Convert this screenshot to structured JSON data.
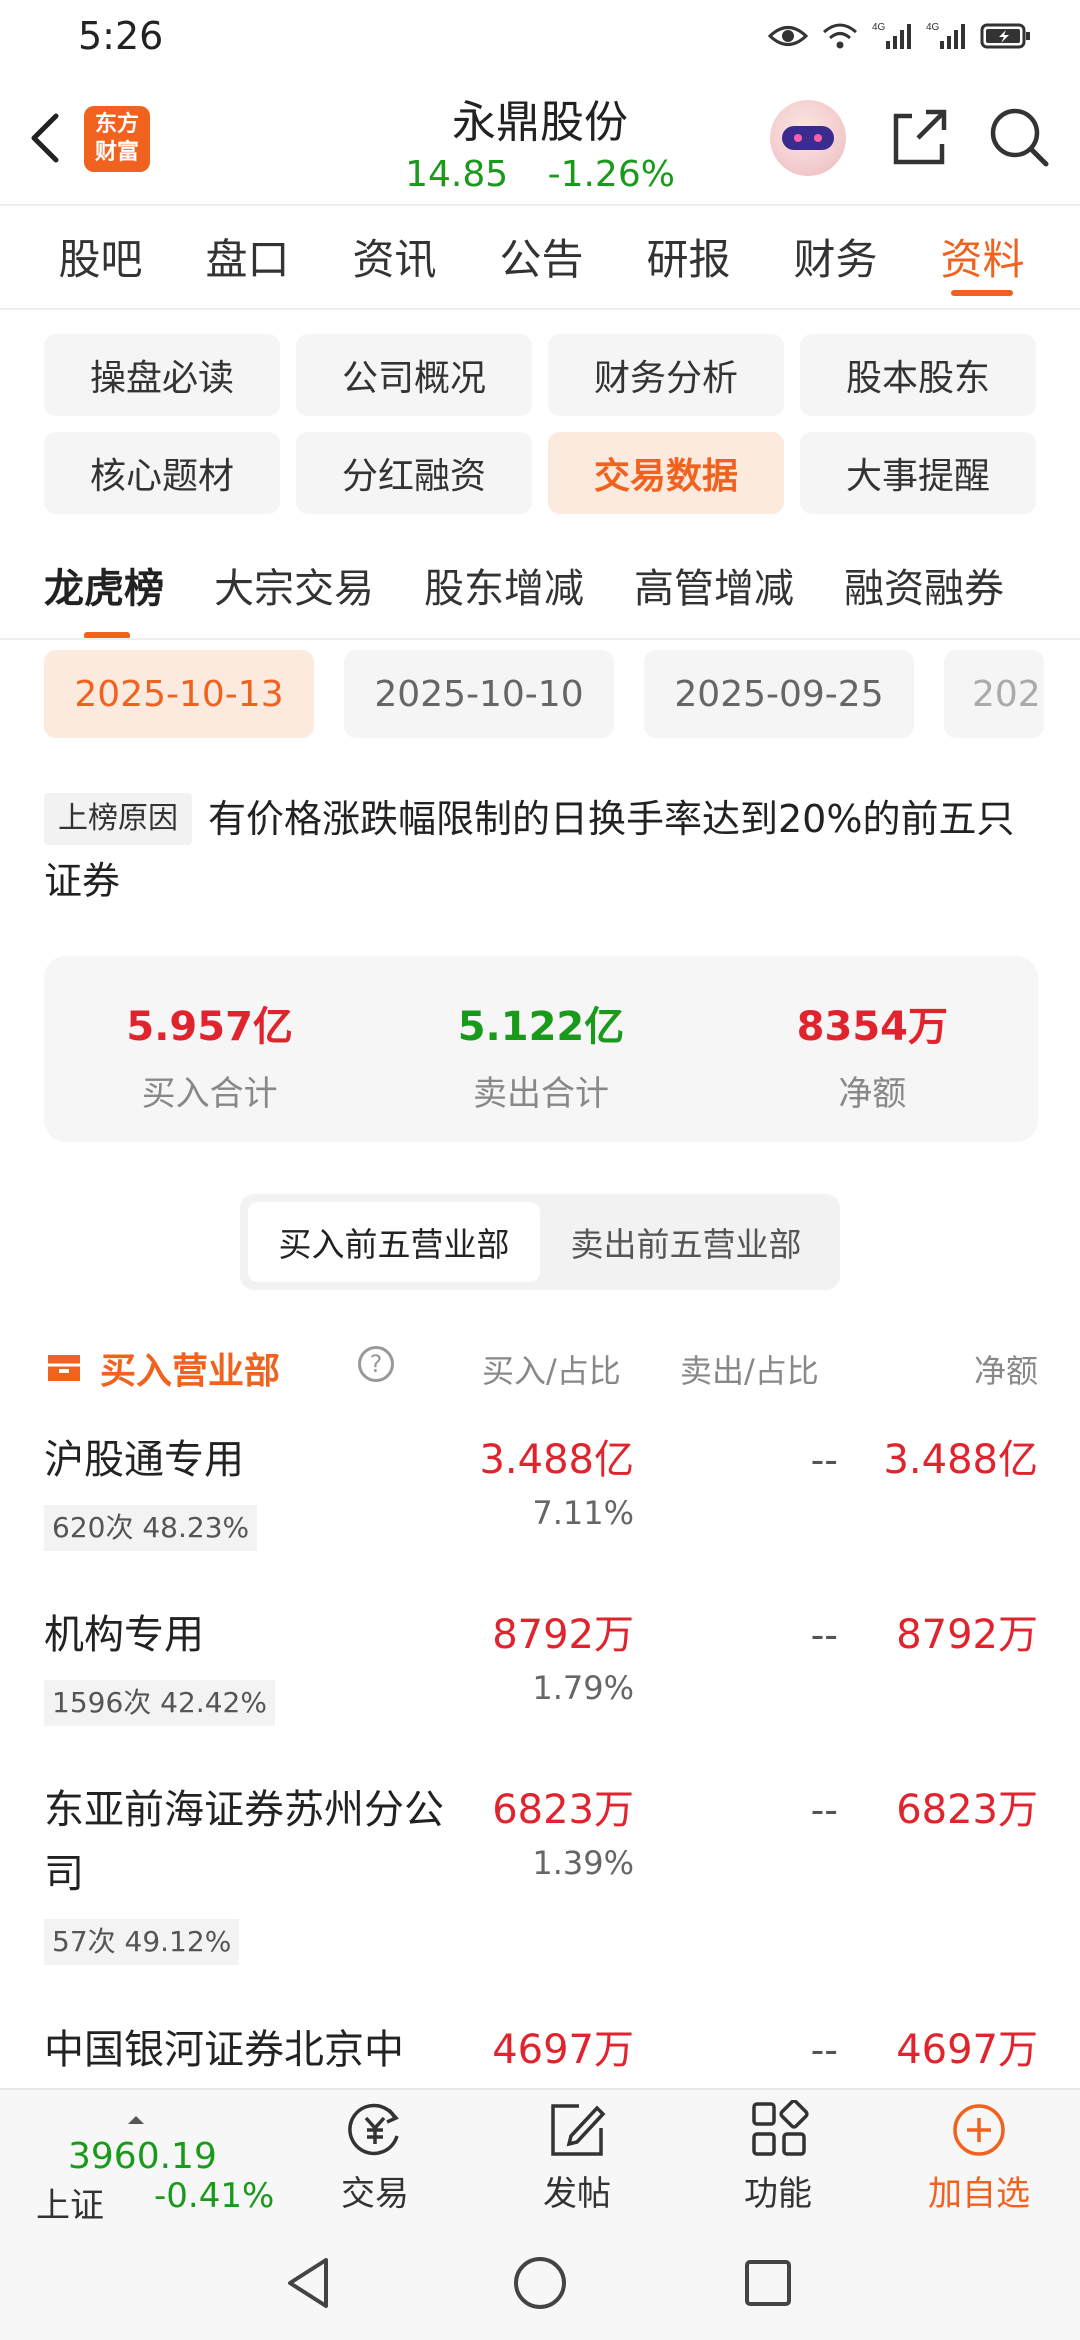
{
  "status_bar": {
    "time": "5:26",
    "net1": "4G",
    "net2": "4G"
  },
  "header": {
    "logo_line1": "东方",
    "logo_line2": "财富",
    "stock_name": "永鼎股份",
    "price": "14.85",
    "change_pct": "-1.26%"
  },
  "main_tabs": [
    {
      "label": "股吧"
    },
    {
      "label": "盘口"
    },
    {
      "label": "资讯"
    },
    {
      "label": "公告"
    },
    {
      "label": "研报"
    },
    {
      "label": "财务"
    },
    {
      "label": "资料",
      "active": true
    }
  ],
  "categories": [
    {
      "label": "操盘必读"
    },
    {
      "label": "公司概况"
    },
    {
      "label": "财务分析"
    },
    {
      "label": "股本股东"
    },
    {
      "label": "核心题材"
    },
    {
      "label": "分红融资"
    },
    {
      "label": "交易数据",
      "active": true
    },
    {
      "label": "大事提醒"
    }
  ],
  "sub_tabs": [
    {
      "label": "龙虎榜",
      "active": true
    },
    {
      "label": "大宗交易"
    },
    {
      "label": "股东增减"
    },
    {
      "label": "高管增减"
    },
    {
      "label": "融资融券"
    }
  ],
  "dates": [
    {
      "label": "2025-10-13",
      "active": true
    },
    {
      "label": "2025-10-10"
    },
    {
      "label": "2025-09-25"
    },
    {
      "label": "202"
    }
  ],
  "reason": {
    "tag": "上榜原因",
    "text": "有价格涨跌幅限制的日换手率达到20%的前五只证券"
  },
  "summary": {
    "buy_total": "5.957亿",
    "buy_label": "买入合计",
    "sell_total": "5.122亿",
    "sell_label": "卖出合计",
    "net": "8354万",
    "net_label": "净额"
  },
  "segment": {
    "buy_top": "买入前五营业部",
    "sell_top": "卖出前五营业部"
  },
  "table": {
    "title": "买入营业部",
    "help": "?",
    "col_buy": "买入/占比",
    "col_sell": "卖出/占比",
    "col_net": "净额",
    "rows": [
      {
        "name": "沪股通专用",
        "stats": "620次 48.23%",
        "buy": "3.488亿",
        "buy_pct": "7.11%",
        "sell": "--",
        "net": "3.488亿"
      },
      {
        "name": "机构专用",
        "stats": "1596次 42.42%",
        "buy": "8792万",
        "buy_pct": "1.79%",
        "sell": "--",
        "net": "8792万"
      },
      {
        "name": "东亚前海证券苏州分公司",
        "stats": "57次 49.12%",
        "buy": "6823万",
        "buy_pct": "1.39%",
        "sell": "--",
        "net": "6823万"
      },
      {
        "name": "中国银河证券北京中",
        "buy": "4697万",
        "sell": "--",
        "net": "4697万"
      }
    ]
  },
  "bottom_nav": {
    "index_value": "3960.19",
    "index_name": "上证",
    "index_change": "-0.41%",
    "trade": "交易",
    "post": "发帖",
    "functions": "功能",
    "add_watch": "加自选"
  },
  "colors": {
    "accent": "#f0621e",
    "up": "#e0232c",
    "down": "#1a9a1a"
  }
}
